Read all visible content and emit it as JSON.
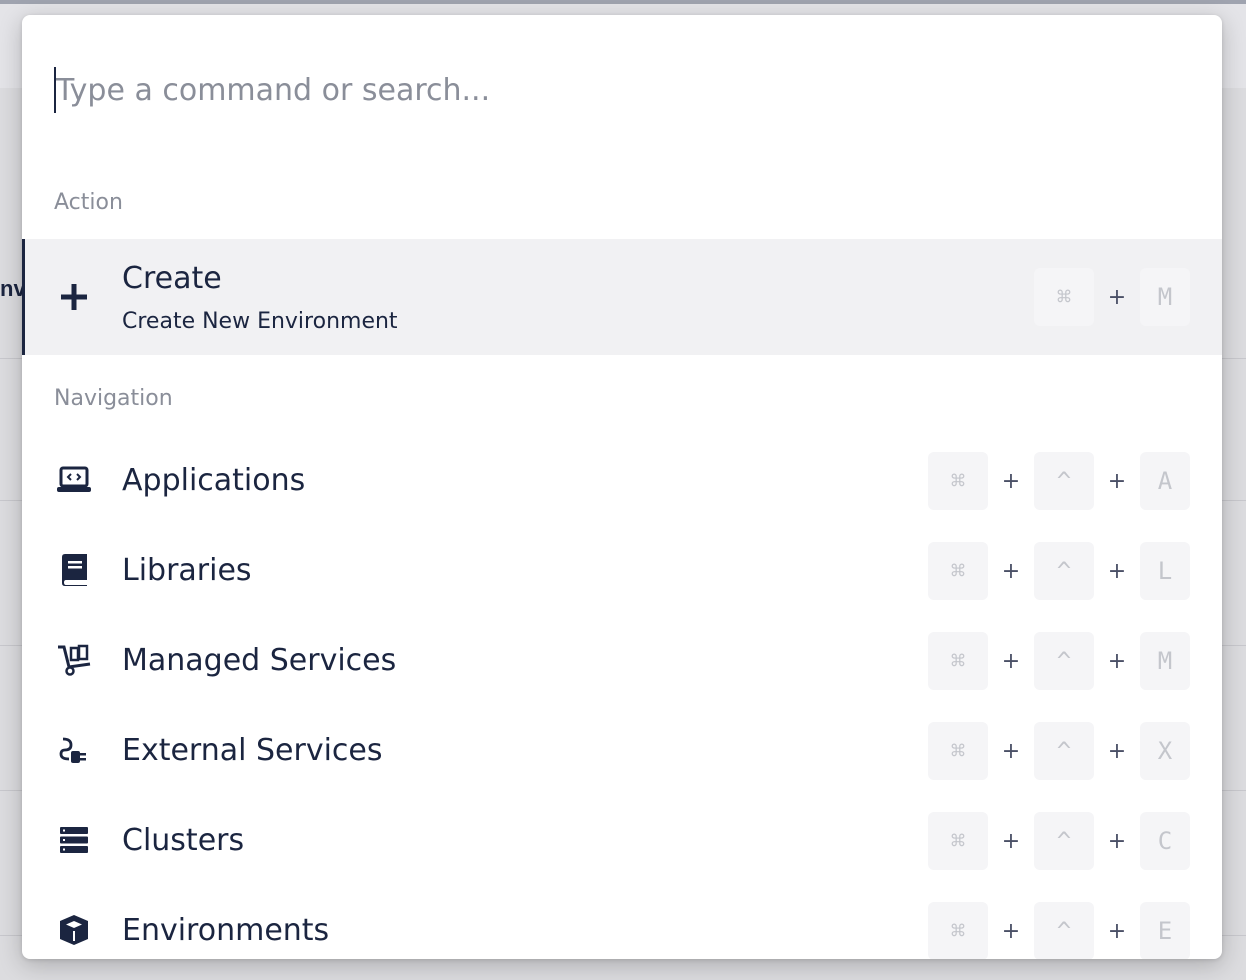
{
  "search": {
    "placeholder": "Type a command or search..."
  },
  "background": {
    "peek_text": "nv"
  },
  "sections": {
    "action": "Action",
    "navigation": "Navigation"
  },
  "action_items": [
    {
      "title": "Create",
      "subtitle": "Create New Environment",
      "icon": "plus-icon",
      "keys": [
        "⌘",
        "M"
      ]
    }
  ],
  "nav_items": [
    {
      "title": "Applications",
      "icon": "laptop-code-icon",
      "keys": [
        "⌘",
        "^",
        "A"
      ]
    },
    {
      "title": "Libraries",
      "icon": "book-icon",
      "keys": [
        "⌘",
        "^",
        "L"
      ]
    },
    {
      "title": "Managed Services",
      "icon": "dolly-icon",
      "keys": [
        "⌘",
        "^",
        "M"
      ]
    },
    {
      "title": "External Services",
      "icon": "plug-icon",
      "keys": [
        "⌘",
        "^",
        "X"
      ]
    },
    {
      "title": "Clusters",
      "icon": "server-list-icon",
      "keys": [
        "⌘",
        "^",
        "C"
      ]
    },
    {
      "title": "Environments",
      "icon": "cube-icon",
      "keys": [
        "⌘",
        "^",
        "E"
      ]
    }
  ],
  "plus_sign": "+",
  "colors": {
    "accent": "#1b2540",
    "muted": "#8a8e99",
    "active_bg": "#f1f1f3"
  }
}
